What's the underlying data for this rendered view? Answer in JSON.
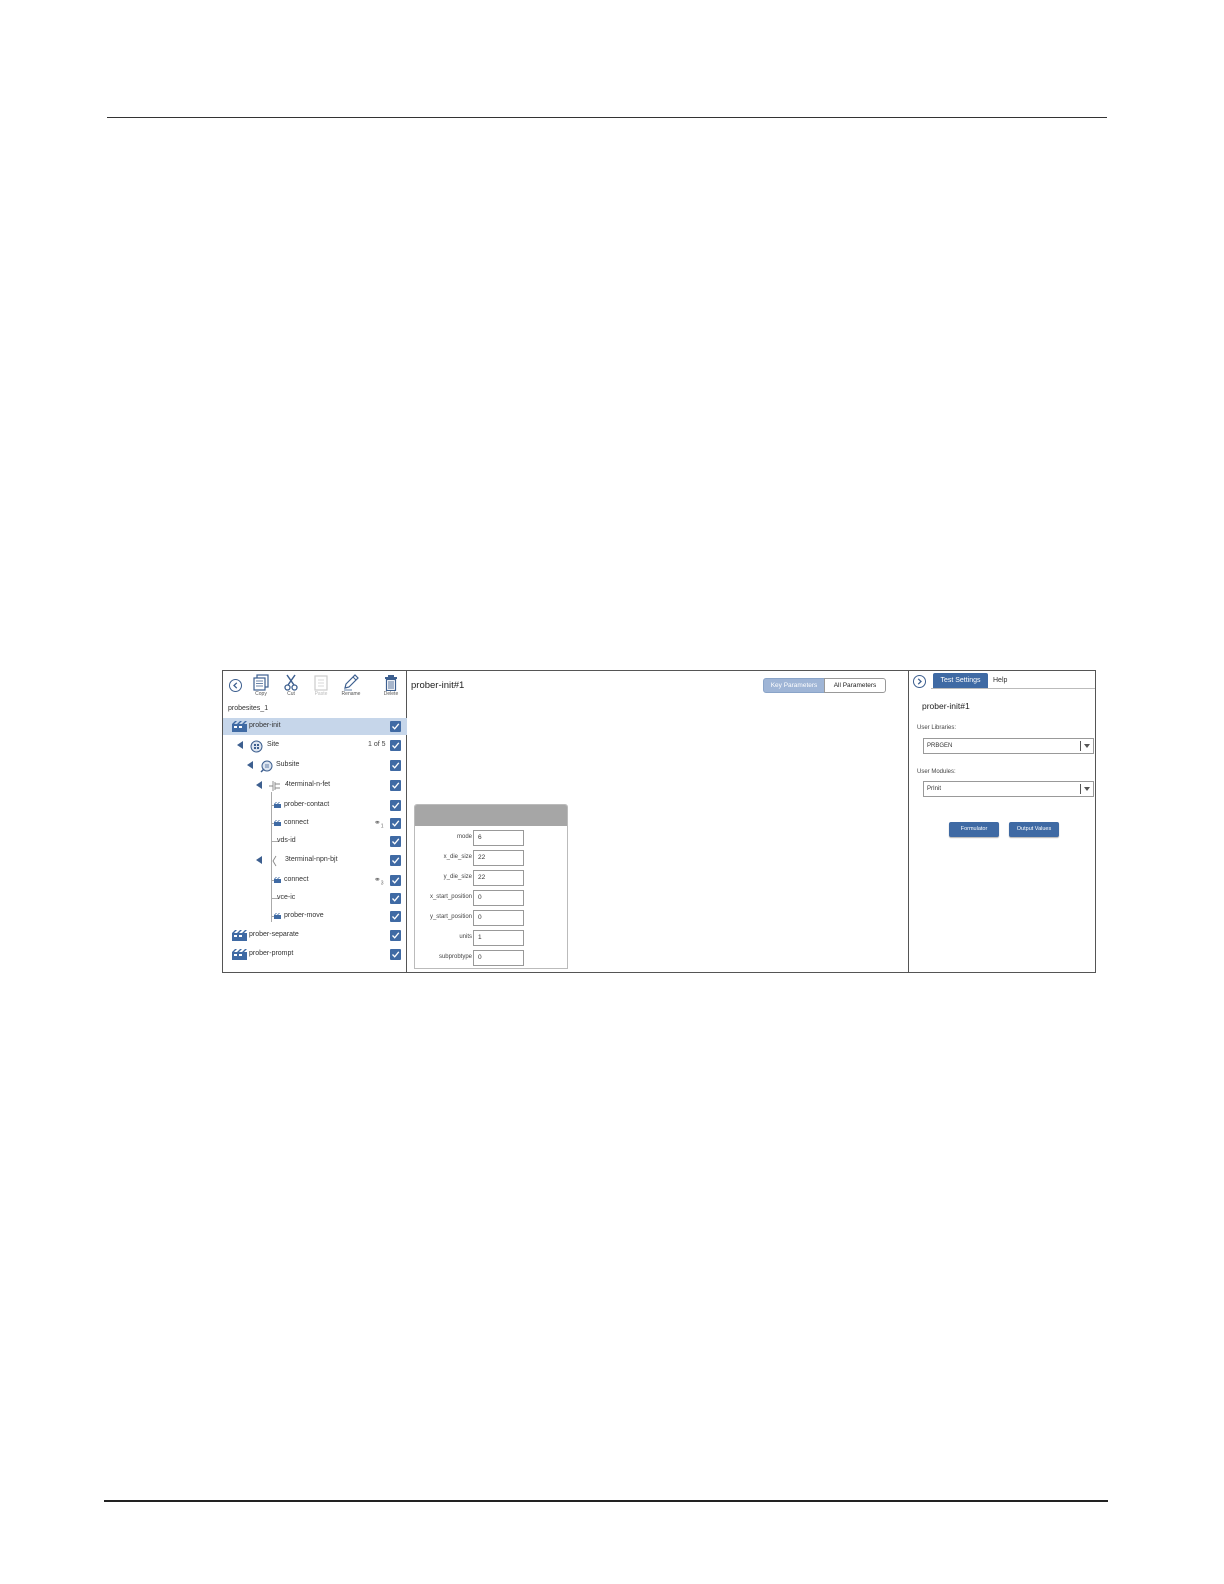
{
  "toolbar": {
    "copy_label": "Copy",
    "cut_label": "Cut",
    "paste_label": "Paste",
    "rename_label": "Rename",
    "delete_label": "Delete"
  },
  "project_name": "probesites_1",
  "tree": [
    {
      "label": "prober-init",
      "icon": "action-icon",
      "checked": true,
      "selected": true
    },
    {
      "label": "Site",
      "icon": "site-icon",
      "checked": true,
      "count": "1 of 5"
    },
    {
      "label": "Subsite",
      "icon": "subsite-icon",
      "checked": true
    },
    {
      "label": "4terminal-n-fet",
      "icon": "device-icon",
      "checked": true
    },
    {
      "label": "prober-contact",
      "icon": "action-icon",
      "checked": true
    },
    {
      "label": "connect",
      "icon": "action-icon",
      "checked": true,
      "link": "1"
    },
    {
      "label": "vds-id",
      "checked": true
    },
    {
      "label": "3terminal-npn-bjt",
      "icon": "device-icon",
      "checked": true
    },
    {
      "label": "connect",
      "icon": "action-icon",
      "checked": true,
      "link": "3"
    },
    {
      "label": "vce-ic",
      "checked": true
    },
    {
      "label": "prober-move",
      "icon": "action-icon",
      "checked": true
    },
    {
      "label": "prober-separate",
      "icon": "action-icon",
      "checked": true
    },
    {
      "label": "prober-prompt",
      "icon": "action-icon",
      "checked": true
    }
  ],
  "middle": {
    "title": "prober-init#1",
    "tab_key": "Key Parameters",
    "tab_all": "All Parameters",
    "params": [
      {
        "label": "mode",
        "value": "6"
      },
      {
        "label": "x_die_size",
        "value": "22"
      },
      {
        "label": "y_die_size",
        "value": "22"
      },
      {
        "label": "x_start_position",
        "value": "0"
      },
      {
        "label": "y_start_position",
        "value": "0"
      },
      {
        "label": "units",
        "value": "1"
      },
      {
        "label": "subprobtype",
        "value": "0"
      }
    ]
  },
  "right": {
    "tab_settings": "Test Settings",
    "tab_help": "Help",
    "title": "prober-init#1",
    "libraries_label": "User Libraries:",
    "libraries_value": "PRBGEN",
    "modules_label": "User Modules:",
    "modules_value": "PrInit",
    "formulator_label": "Formulator",
    "output_label": "Output Values"
  },
  "colors": {
    "accent": "#3f6aa4",
    "selected_row": "#c6d6ea",
    "card_header": "#a6a6a6"
  }
}
